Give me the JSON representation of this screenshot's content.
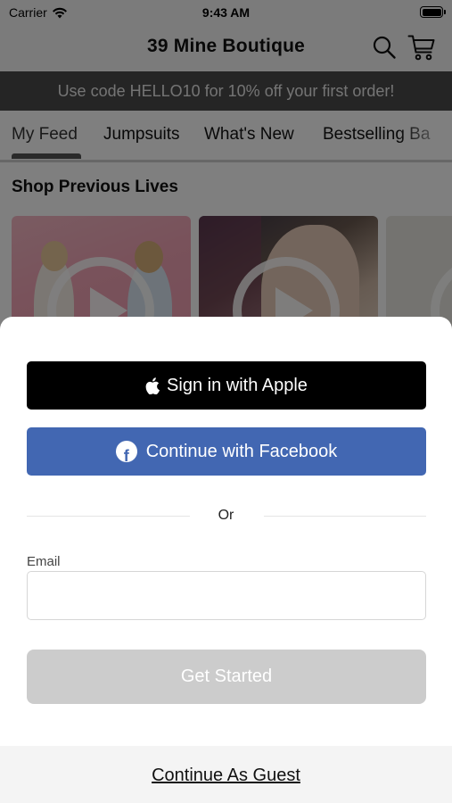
{
  "status_bar": {
    "carrier": "Carrier",
    "time": "9:43 AM"
  },
  "header": {
    "title": "39 Mine Boutique",
    "icons": [
      "search-icon",
      "cart-icon"
    ]
  },
  "promo": {
    "text": "Use code HELLO10 for 10% off your first order!"
  },
  "tabs": [
    {
      "label": "My Feed",
      "active": true
    },
    {
      "label": "Jumpsuits",
      "active": false
    },
    {
      "label": "What's New",
      "active": false
    },
    {
      "label": "Bestselling Ba",
      "active": false
    }
  ],
  "feed": {
    "section_title": "Shop Previous Lives"
  },
  "sheet": {
    "apple_button": "Sign in with Apple",
    "facebook_button": "Continue with Facebook",
    "or_text": "Or",
    "email_label": "Email",
    "email_value": "",
    "email_placeholder": "",
    "get_started_button": "Get Started",
    "guest_link": "Continue As Guest"
  },
  "colors": {
    "apple": "#000000",
    "facebook": "#4267b2",
    "promo_bg": "#4a4a4a",
    "disabled_button": "#cccccc"
  }
}
